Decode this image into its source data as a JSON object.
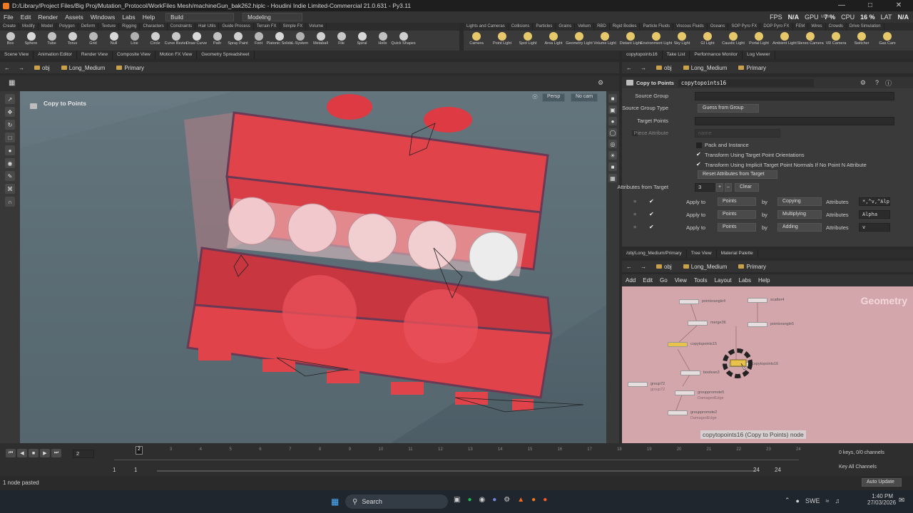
{
  "window": {
    "title": "D:/Library/Project Files/Big Proj/Mutation_Protocol/WorkFiles Mesh/machineGun_bak262.hiplc - Houdini Indie Limited-Commercial 21.0.631 - Py3.11"
  },
  "menubar": {
    "items": [
      "File",
      "Edit",
      "Render",
      "Assets",
      "Windows",
      "Labs",
      "Help"
    ],
    "desktop_dropdown": "Build",
    "context_dropdown": "Modeling",
    "main_label": "Main",
    "perf": {
      "fps_label": "FPS",
      "fps_value": "N/A",
      "gpu_label": "GPU",
      "gpu_value": "7 %",
      "cpu_label": "CPU",
      "cpu_value": "16 %",
      "lat_label": "LAT",
      "lat_value": "N/A"
    }
  },
  "shelf_tabs_left": [
    "Create",
    "Modify",
    "Model",
    "Polygon",
    "Deform",
    "Texture",
    "Rigging",
    "Characters",
    "Constraints",
    "Hair Utils",
    "Guide Process",
    "Terrain FX",
    "Simple FX",
    "Volume"
  ],
  "shelf_tabs_right": [
    "Lights and Cameras",
    "Collisions",
    "Particles",
    "Grains",
    "Vellum",
    "RBD",
    "Rigid Bodies",
    "Particle Fluids",
    "Viscous Fluids",
    "Oceans",
    "SOP Pyro FX",
    "DOP Pyro FX",
    "FEM",
    "Wires",
    "Crowds",
    "Drive Simulation"
  ],
  "shelf_tools_left": [
    "Box",
    "Sphere",
    "Tube",
    "Torus",
    "Grid",
    "Null",
    "Line",
    "Circle",
    "Curve Bezier",
    "Draw Curve",
    "Path",
    "Spray Paint",
    "Font",
    "Platonic Solids",
    "L-System",
    "Metaball",
    "File",
    "Spiral",
    "Helix",
    "Quick Shapes"
  ],
  "shelf_tools_right": [
    "Camera",
    "Point Light",
    "Spot Light",
    "Area Light",
    "Geometry Light",
    "Volume Light",
    "Distant Light",
    "Environment Light",
    "Sky Light",
    "GI Light",
    "Caustic Light",
    "Portal Light",
    "Ambient Light",
    "Stereo Camera",
    "VR Camera",
    "Switcher",
    "Gas Cam"
  ],
  "pane_tabs_left": [
    "Scene View",
    "Animation Editor",
    "Render View",
    "Composite View",
    "Motion FX View",
    "Geometry Spreadsheet"
  ],
  "pane_tabs_right": [
    "copytopoints16",
    "Take List",
    "Performance Monitor",
    "Log Viewer"
  ],
  "viewport": {
    "path": [
      "obj",
      "Long_Medium",
      "Primary"
    ],
    "node_title": "Copy to Points",
    "persp": "Persp",
    "camera": "No cam"
  },
  "params": {
    "path": [
      "obj",
      "Long_Medium",
      "Primary"
    ],
    "node_type": "Copy to Points",
    "node_name": "copytopoints16",
    "source_group_label": "Source Group",
    "source_group_type_label": "Source Group Type",
    "source_group_type_value": "Guess from Group",
    "target_points_label": "Target Points",
    "piece_attribute_label": "Piece Attribute",
    "piece_attribute_value": "name",
    "pack_instance": "Pack and Instance",
    "transform_orient": "Transform Using Target Point Orientations",
    "transform_normals": "Transform Using Implicit Target Point Normals If No Point N Attribute",
    "reset_button": "Reset Attributes from Target",
    "attrs_from_target_label": "Attributes from Target",
    "attrs_from_target_value": "3",
    "clear_button": "Clear",
    "rows": [
      {
        "apply_to": "Apply to",
        "target": "Points",
        "by": "by",
        "method": "Copying",
        "attributes_label": "Attributes",
        "attributes": "*,^v,^Alp"
      },
      {
        "apply_to": "Apply to",
        "target": "Points",
        "by": "by",
        "method": "Multiplying",
        "attributes_label": "Attributes",
        "attributes": "Alpha"
      },
      {
        "apply_to": "Apply to",
        "target": "Points",
        "by": "by",
        "method": "Adding",
        "attributes_label": "Attributes",
        "attributes": "v"
      }
    ]
  },
  "network": {
    "tabs": [
      "/obj/Long_Medium/Primary",
      "Tree View",
      "Material Palette"
    ],
    "path": [
      "obj",
      "Long_Medium",
      "Primary"
    ],
    "menu": [
      "Add",
      "Edit",
      "Go",
      "View",
      "Tools",
      "Layout",
      "Labs",
      "Help"
    ],
    "context_label": "Geometry",
    "nodes": [
      {
        "name": "pointsrangle4",
        "sub": ""
      },
      {
        "name": "scatter4",
        "sub": ""
      },
      {
        "name": "merge36",
        "sub": ""
      },
      {
        "name": "pointsrangle5",
        "sub": ""
      },
      {
        "name": "copytopoints15",
        "sub": ""
      },
      {
        "name": "copytopoints16",
        "sub": ""
      },
      {
        "name": "boolean3",
        "sub": ""
      },
      {
        "name": "group72",
        "sub": "group72"
      },
      {
        "name": "grouppromote5",
        "sub": "DamagedEdge"
      },
      {
        "name": "grouppromote2",
        "sub": "DamagedEdge"
      }
    ],
    "tooltip": "copytopoints16 (Copy to Points) node"
  },
  "timeline": {
    "current_frame": "2",
    "ticks": [
      "2",
      "3",
      "4",
      "5",
      "6",
      "7",
      "8",
      "9",
      "10",
      "11",
      "12",
      "13",
      "14",
      "15",
      "16",
      "17",
      "18",
      "19",
      "20",
      "21",
      "22",
      "23",
      "24"
    ],
    "start": "1",
    "start2": "1",
    "end": "24",
    "end2": "24",
    "keys_info": "0 keys, 0/0 channels",
    "key_all": "Key All Channels",
    "auto_update": "Auto Update"
  },
  "status": {
    "message": "1 node pasted"
  },
  "taskbar": {
    "search": "Search",
    "lang": "SWE",
    "time": "1:40 PM",
    "date": "27/03/2026"
  },
  "colors": {
    "accent": "#e8c24a",
    "red_mesh": "#e0434a",
    "network_bg": "#d3a6ab"
  }
}
